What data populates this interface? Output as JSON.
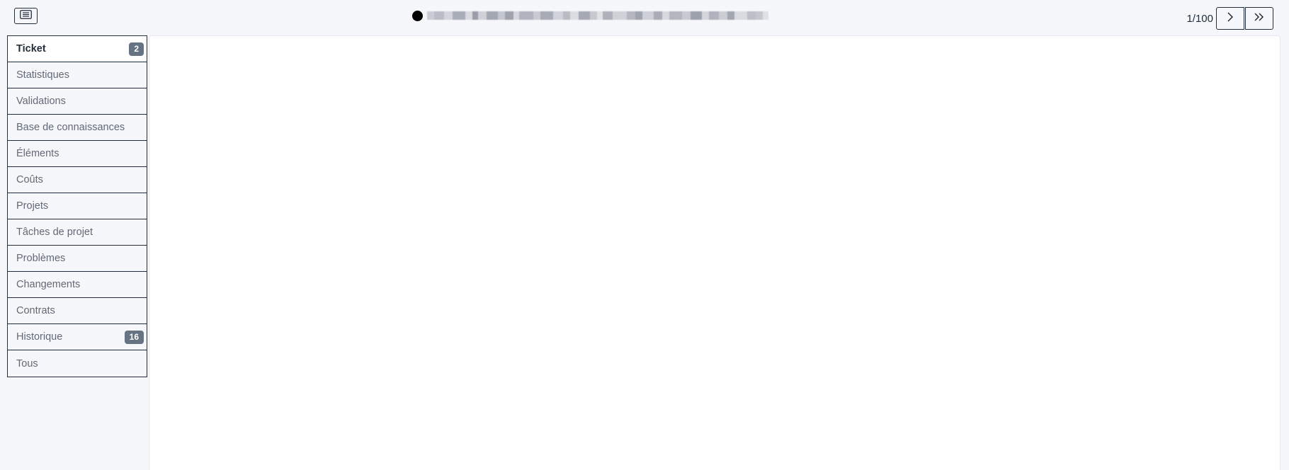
{
  "topbar": {
    "toggle_icon": "list-icon",
    "status_color": "#000000",
    "pager": {
      "count": "1/100",
      "next_icon": "chevron-right-icon",
      "last_icon": "double-chevron-right-icon"
    }
  },
  "sidebar": {
    "items": [
      {
        "label": "Ticket",
        "badge": "2",
        "active": true
      },
      {
        "label": "Statistiques"
      },
      {
        "label": "Validations"
      },
      {
        "label": "Base de connaissances"
      },
      {
        "label": "Éléments"
      },
      {
        "label": "Coûts"
      },
      {
        "label": "Projets"
      },
      {
        "label": "Tâches de projet"
      },
      {
        "label": "Problèmes"
      },
      {
        "label": "Changements"
      },
      {
        "label": "Contrats"
      },
      {
        "label": "Historique",
        "badge": "16"
      },
      {
        "label": "Tous"
      }
    ]
  },
  "colors": {
    "background": "#f5f7fa",
    "content_bg": "#ffffff",
    "text": "#232e3c",
    "muted_text": "#626976",
    "badge_bg": "#667382"
  }
}
